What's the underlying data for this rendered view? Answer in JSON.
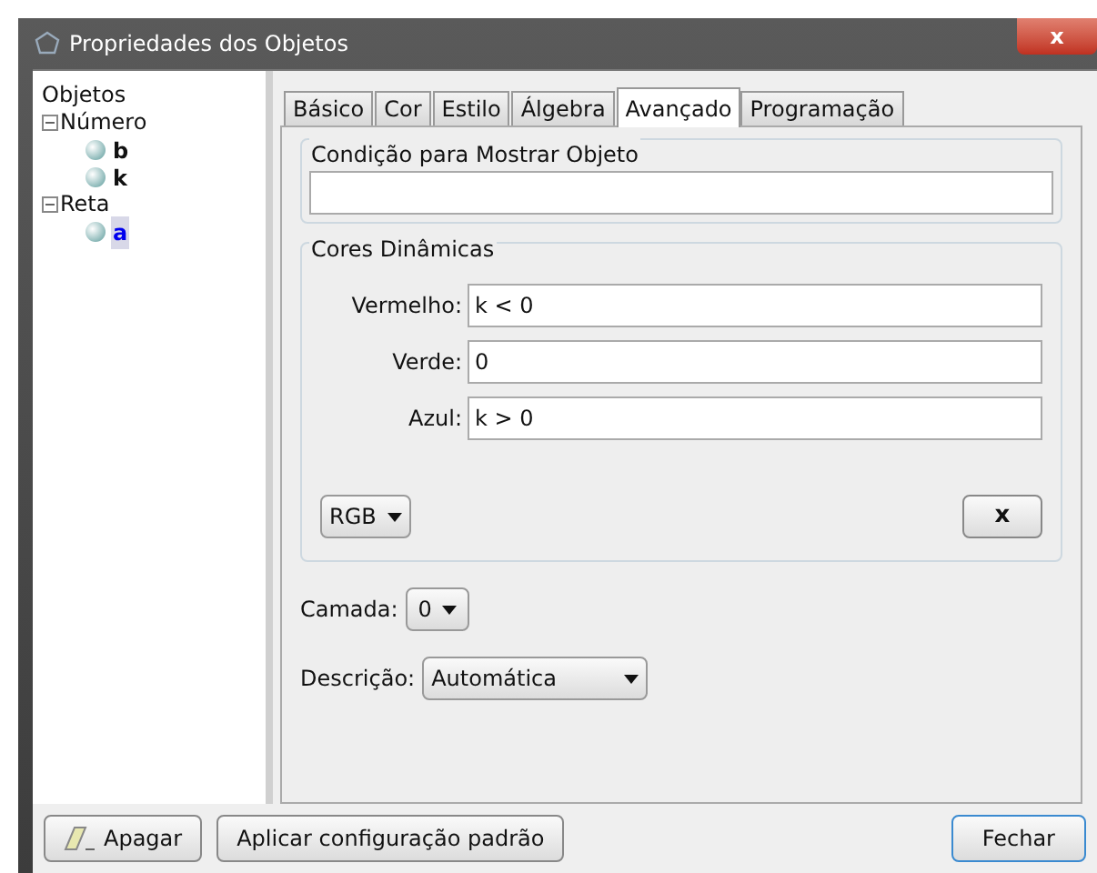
{
  "window": {
    "title": "Propriedades dos Objetos",
    "close_label": "x"
  },
  "tree": {
    "label": "Objetos",
    "children": [
      {
        "label": "Número",
        "expanded": true,
        "toggle": "−",
        "children": [
          {
            "label": "b",
            "selected": false
          },
          {
            "label": "k",
            "selected": false
          }
        ]
      },
      {
        "label": "Reta",
        "expanded": true,
        "toggle": "−",
        "children": [
          {
            "label": "a",
            "selected": true
          }
        ]
      }
    ]
  },
  "tabs": [
    {
      "label": "Básico",
      "selected": false
    },
    {
      "label": "Cor",
      "selected": false
    },
    {
      "label": "Estilo",
      "selected": false
    },
    {
      "label": "Álgebra",
      "selected": false
    },
    {
      "label": "Avançado",
      "selected": true
    },
    {
      "label": "Programação",
      "selected": false
    }
  ],
  "condition": {
    "title": "Condição para Mostrar Objeto"
  },
  "dynamic_colors": {
    "title": "Cores Dinâmicas",
    "fields": [
      {
        "label": "Vermelho:",
        "value": "k < 0"
      },
      {
        "label": "Verde:",
        "value": "0"
      },
      {
        "label": "Azul:",
        "value": "k > 0"
      }
    ],
    "mode": "RGB",
    "clear_button": "x"
  },
  "layer": {
    "label": "Camada:",
    "value": "0"
  },
  "description": {
    "label": "Descrição:",
    "value": "Automática"
  },
  "buttons": [
    {
      "label": "Apagar",
      "kind": "erase"
    },
    {
      "label": "Aplicar configuração padrão",
      "kind": "plain"
    },
    {
      "label": "Fechar",
      "kind": "default"
    }
  ]
}
